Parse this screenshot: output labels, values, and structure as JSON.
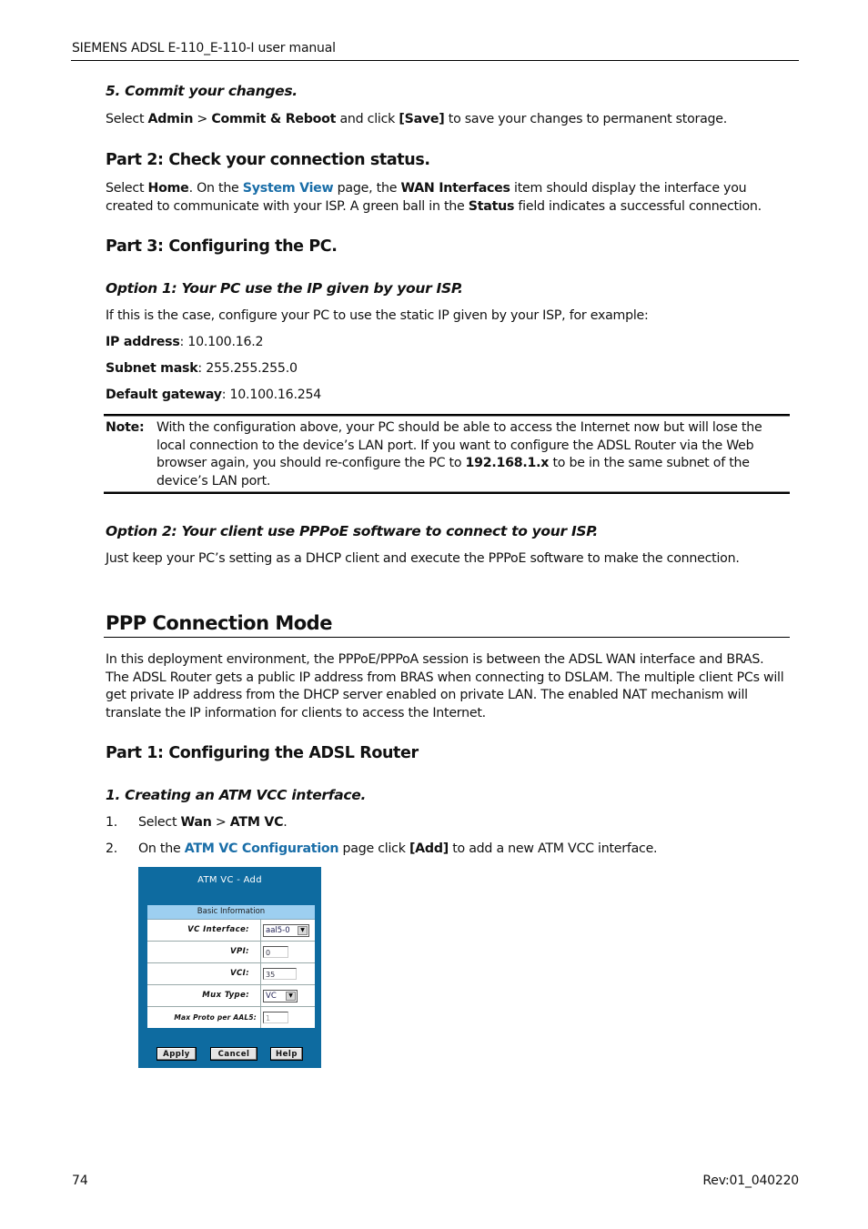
{
  "header": {
    "title": "SIEMENS ADSL E-110_E-110-I user manual"
  },
  "step5": {
    "heading": "5. Commit your changes.",
    "text": {
      "p1": "Select ",
      "b1": "Admin",
      "p2": " > ",
      "b2": "Commit & Reboot",
      "p3": " and click ",
      "b3": "[Save]",
      "p4": " to save your changes to permanent storage."
    }
  },
  "part2": {
    "heading": "Part 2: Check your connection status.",
    "text": {
      "p1": "Select ",
      "b1": "Home",
      "p2": ". On the ",
      "link1": "System View",
      "p3": " page, the ",
      "b2": "WAN Interfaces",
      "p4": " item should display the interface you created to communicate with your ISP. A green ball in the ",
      "b3": "Status",
      "p5": " field indicates a successful connection."
    }
  },
  "part3": {
    "heading": "Part 3: Configuring the PC.",
    "option1": {
      "heading": "Option 1: Your PC use the IP given by your ISP.",
      "intro": "If this is the case, configure your PC to use the static IP given by your ISP, for example:",
      "settings": [
        {
          "label": "IP address",
          "value": ": 10.100.16.2"
        },
        {
          "label": "Subnet mask",
          "value": ": 255.255.255.0"
        },
        {
          "label": "Default gateway",
          "value": ": 10.100.16.254"
        }
      ]
    },
    "note": {
      "label": "Note:",
      "p1": "With the configuration above, your PC should be able to access the Internet now but will lose the local connection to the device’s LAN port. If you want to configure the ADSL Router via the Web browser again, you should re-configure the PC to ",
      "b1": "192.168.1.x",
      "p2": " to be in the same subnet of the device’s LAN port."
    },
    "option2": {
      "heading": "Option 2: Your client use PPPoE software to connect to your ISP.",
      "text": "Just keep your PC’s setting as a DHCP client and execute the PPPoE software to make the connection."
    }
  },
  "ppp": {
    "heading": "PPP Connection Mode",
    "text": "In this deployment environment, the PPPoE/PPPoA session is between the ADSL WAN interface and BRAS. The ADSL Router gets a public IP address from BRAS when connecting to DSLAM. The multiple client PCs will get private IP address from the DHCP server enabled on private LAN. The enabled NAT mechanism will translate the IP information for clients to access the Internet.",
    "part1": {
      "heading": "Part 1: Configuring the ADSL Router",
      "sub": "1. Creating an ATM VCC interface.",
      "steps": [
        {
          "num": "1.",
          "p1": "Select ",
          "b1": "Wan",
          "p2": " > ",
          "b2": "ATM VC",
          "p3": "."
        },
        {
          "num": "2.",
          "p1": "On the ",
          "link1": "ATM VC Configuration",
          "p2": " page click ",
          "b1": "[Add]",
          "p3": " to add a new ATM VCC interface."
        }
      ]
    }
  },
  "atm_form": {
    "title": "ATM VC - Add",
    "section": "Basic Information",
    "fields": [
      {
        "label": "VC Interface:",
        "value": "aal5-0",
        "type": "select"
      },
      {
        "label": "VPI:",
        "value": "0",
        "type": "input"
      },
      {
        "label": "VCI:",
        "value": "35",
        "type": "input"
      },
      {
        "label": "Mux Type:",
        "value": "VC",
        "type": "select"
      },
      {
        "label": "Max Proto per AAL5:",
        "value": "1",
        "type": "input-disabled"
      }
    ],
    "buttons": {
      "apply": "Apply",
      "cancel": "Cancel",
      "help": "Help"
    },
    "colors": {
      "background": "#0e6ba0",
      "section": "#9dcff0"
    }
  },
  "footer": {
    "page": "74",
    "rev": "Rev:01_040220"
  }
}
